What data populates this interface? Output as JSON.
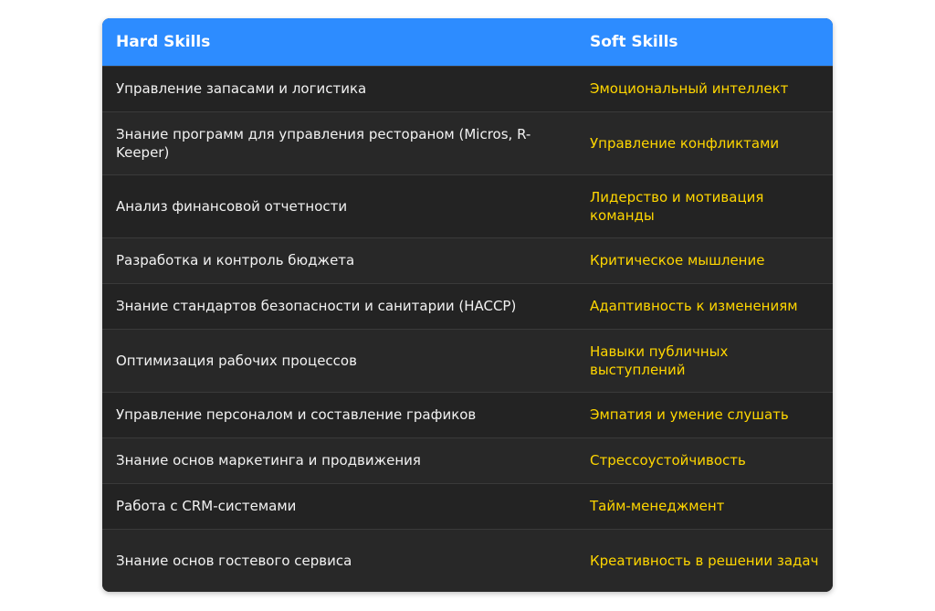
{
  "table": {
    "headers": {
      "hard": "Hard Skills",
      "soft": "Soft Skills"
    },
    "rows": [
      {
        "hard": "Управление запасами и логистика",
        "soft": "Эмоциональный интеллект"
      },
      {
        "hard": "Знание программ для управления рестораном (Micros, R-Keeper)",
        "soft": "Управление конфликтами"
      },
      {
        "hard": "Анализ финансовой отчетности",
        "soft": "Лидерство и мотивация команды"
      },
      {
        "hard": "Разработка и контроль бюджета",
        "soft": "Критическое мышление"
      },
      {
        "hard": "Знание стандартов безопасности и санитарии (HACCP)",
        "soft": "Адаптивность к изменениям"
      },
      {
        "hard": "Оптимизация рабочих процессов",
        "soft": "Навыки публичных выступлений"
      },
      {
        "hard": "Управление персоналом и составление графиков",
        "soft": "Эмпатия и умение слушать"
      },
      {
        "hard": "Знание основ маркетинга и продвижения",
        "soft": "Стрессоустойчивость"
      },
      {
        "hard": "Работа с CRM-системами",
        "soft": "Тайм-менеджмент"
      },
      {
        "hard": "Знание основ гостевого сервиса",
        "soft": "Креативность в решении задач"
      }
    ]
  },
  "colors": {
    "header_bg": "#2d8cff",
    "body_bg": "#232323",
    "hard_text": "#f2f2f2",
    "soft_text": "#ffd600"
  }
}
